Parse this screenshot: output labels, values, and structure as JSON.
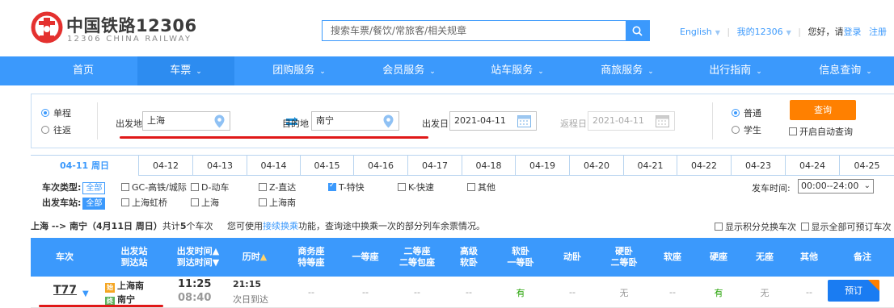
{
  "header": {
    "logo_cn": "中国铁路12306",
    "logo_en": "12306 CHINA RAILWAY",
    "search_placeholder": "搜索车票/餐饮/常旅客/相关规章",
    "links": {
      "english": "English",
      "my12306": "我的12306",
      "greeting": "您好，请",
      "login": "登录",
      "register": "注册"
    }
  },
  "nav": [
    "首页",
    "车票",
    "团购服务",
    "会员服务",
    "站车服务",
    "商旅服务",
    "出行指南",
    "信息查询"
  ],
  "search": {
    "trip_oneway": "单程",
    "trip_round": "往返",
    "from_label": "出发地",
    "from_value": "上海",
    "to_label": "目的地",
    "to_value": "南宁",
    "depart_label": "出发日",
    "depart_value": "2021-04-11",
    "return_label": "返程日",
    "return_value": "2021-04-11",
    "ptype_normal": "普通",
    "ptype_student": "学生",
    "query_button": "查询",
    "auto_query": "开启自动查询"
  },
  "date_tabs": [
    "04-11 周日",
    "04-12",
    "04-13",
    "04-14",
    "04-15",
    "04-16",
    "04-17",
    "04-18",
    "04-19",
    "04-20",
    "04-21",
    "04-22",
    "04-23",
    "04-24",
    "04-25"
  ],
  "filters": {
    "train_type_label": "车次类型:",
    "station_label": "出发车站:",
    "all": "全部",
    "types": [
      "GC-高铁/城际",
      "D-动车",
      "Z-直达",
      "T-特快",
      "K-快速",
      "其他"
    ],
    "stations": [
      "上海虹桥",
      "上海",
      "上海南"
    ],
    "time_label": "发车时间:",
    "time_value": "00:00--24:00"
  },
  "summary": {
    "route": "上海 --> 南宁（4月11日 周日）",
    "count_prefix": "共计",
    "count": "5",
    "count_suffix": "个车次",
    "note_prefix": "您可使用",
    "note_link": "接续换乘",
    "note_suffix": "功能，查询途中换乘一次的部分列车余票情况。",
    "check_points": "显示积分兑换车次",
    "check_all": "显示全部可预订车次"
  },
  "table": {
    "headers": {
      "train": "车次",
      "station1": "出发站",
      "station2": "到达站",
      "time1": "出发时间",
      "time2": "到达时间",
      "duration": "历时",
      "biz1": "商务座",
      "biz2": "特等座",
      "first": "一等座",
      "second1": "二等座",
      "second2": "二等包座",
      "hsleep1": "高级",
      "hsleep2": "软卧",
      "soft1": "软卧",
      "soft2": "一等卧",
      "move": "动卧",
      "hard1": "硬卧",
      "hard2": "二等卧",
      "softseat": "软座",
      "hardseat": "硬座",
      "noseat": "无座",
      "other": "其他",
      "remark": "备注"
    },
    "row": {
      "train_no": "T77",
      "from": "上海南",
      "to": "南宁",
      "from_tag": "始",
      "to_tag": "终",
      "depart": "11:25",
      "arrive": "08:40",
      "duration": "21:15",
      "arrive_day": "次日到达",
      "cells": [
        "--",
        "--",
        "--",
        "--",
        "有",
        "--",
        "无",
        "--",
        "有",
        "无",
        "--"
      ],
      "book": "预订"
    }
  }
}
